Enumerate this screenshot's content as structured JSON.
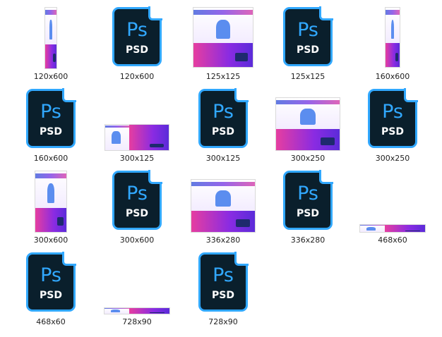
{
  "files": [
    {
      "label": "120x600",
      "kind": "banner"
    },
    {
      "label": "120x600",
      "kind": "psd"
    },
    {
      "label": "125x125",
      "kind": "banner"
    },
    {
      "label": "125x125",
      "kind": "psd"
    },
    {
      "label": "160x600",
      "kind": "banner"
    },
    {
      "label": "160x600",
      "kind": "psd"
    },
    {
      "label": "300x125",
      "kind": "banner"
    },
    {
      "label": "300x125",
      "kind": "psd"
    },
    {
      "label": "300x250",
      "kind": "banner"
    },
    {
      "label": "300x250",
      "kind": "psd"
    },
    {
      "label": "300x600",
      "kind": "banner"
    },
    {
      "label": "300x600",
      "kind": "psd"
    },
    {
      "label": "336x280",
      "kind": "banner"
    },
    {
      "label": "336x280",
      "kind": "psd"
    },
    {
      "label": "468x60",
      "kind": "banner"
    },
    {
      "label": "468x60",
      "kind": "psd"
    },
    {
      "label": "728x90",
      "kind": "banner"
    },
    {
      "label": "728x90",
      "kind": "psd"
    }
  ],
  "psd_icon": {
    "ps_text": "Ps",
    "ext_text": "PSD",
    "accent": "#31a8ff",
    "bg": "#0a1f2c"
  }
}
